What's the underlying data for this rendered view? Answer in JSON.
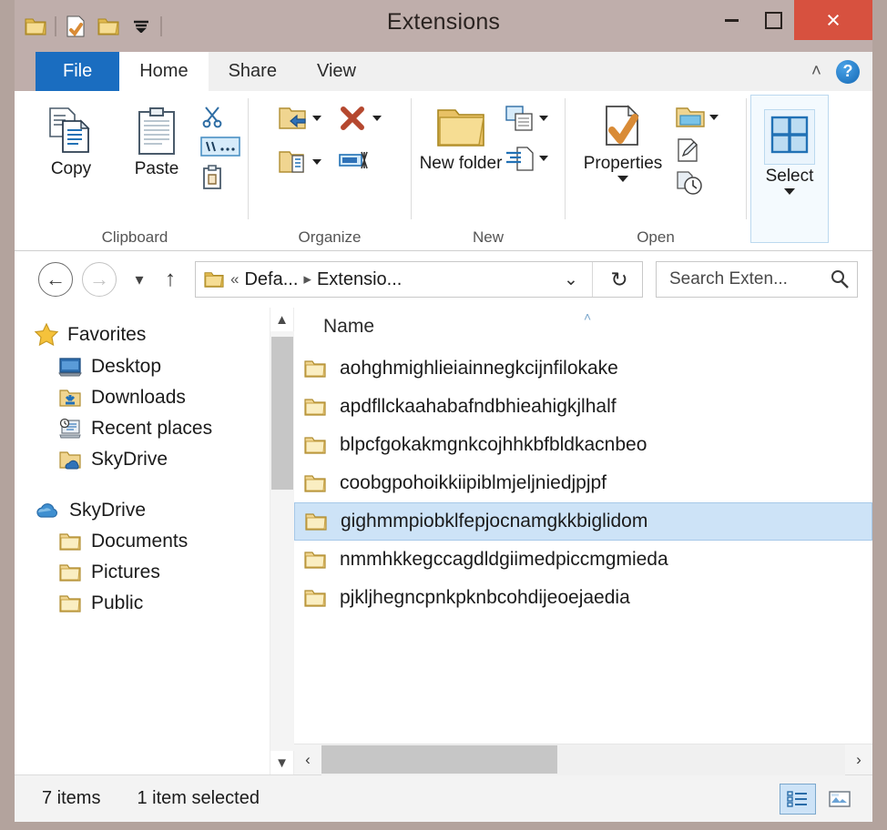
{
  "window": {
    "title": "Extensions",
    "quick_access": [
      "folder-icon",
      "separator",
      "properties-icon",
      "new-folder-icon",
      "dropdown-caret",
      "separator"
    ],
    "controls": {
      "minimize": "minimize-button",
      "maximize": "maximize-button",
      "close": "×"
    }
  },
  "ribbon": {
    "tabs": [
      {
        "label": "File",
        "state": "file"
      },
      {
        "label": "Home",
        "state": "active"
      },
      {
        "label": "Share",
        "state": "normal"
      },
      {
        "label": "View",
        "state": "normal"
      }
    ],
    "collapse_icon": "˄",
    "help_label": "?",
    "groups": [
      {
        "name": "Clipboard",
        "label": "Clipboard",
        "big_buttons": [
          {
            "label": "Copy",
            "icon": "copy-icon"
          },
          {
            "label": "Paste",
            "icon": "paste-icon"
          }
        ],
        "small_buttons": [
          {
            "icon": "cut-icon"
          },
          {
            "icon": "copy-path-icon"
          },
          {
            "icon": "paste-shortcut-icon"
          }
        ]
      },
      {
        "name": "Organize",
        "label": "Organize",
        "small_buttons": [
          {
            "icon": "move-to-icon",
            "caret": true
          },
          {
            "icon": "copy-to-icon",
            "caret": true
          },
          {
            "icon": "delete-icon",
            "caret": true
          },
          {
            "icon": "rename-icon",
            "caret": false
          }
        ]
      },
      {
        "name": "New",
        "label": "New",
        "big_buttons": [
          {
            "label": "New folder",
            "icon": "new-folder-icon"
          }
        ],
        "small_buttons": [
          {
            "icon": "new-item-icon",
            "caret": true
          },
          {
            "icon": "easy-access-icon",
            "caret": true
          }
        ]
      },
      {
        "name": "Open",
        "label": "Open",
        "big_buttons": [
          {
            "label": "Properties",
            "icon": "properties-icon",
            "caret": true
          }
        ],
        "small_buttons": [
          {
            "icon": "open-icon",
            "caret": true
          },
          {
            "icon": "edit-icon",
            "caret": false
          },
          {
            "icon": "history-icon",
            "caret": false
          }
        ]
      },
      {
        "name": "Select",
        "label": "",
        "big_buttons": [
          {
            "label": "Select",
            "icon": "select-grid-icon",
            "caret": true
          }
        ]
      }
    ]
  },
  "addressbar": {
    "back": "←",
    "forward": "→",
    "recent_caret": "▾",
    "up": "↑",
    "breadcrumb": {
      "icon": "folder-icon",
      "overflow": "«",
      "items": [
        "Defa...",
        "Extensio..."
      ],
      "separator": "▸",
      "caret": "⌄"
    },
    "refresh_icon": "↻",
    "search": {
      "placeholder": "Search Exten...",
      "icon": "search-icon"
    }
  },
  "navpane": {
    "sections": [
      {
        "root": {
          "label": "Favorites",
          "icon": "star-icon"
        },
        "items": [
          {
            "label": "Desktop",
            "icon": "desktop-icon"
          },
          {
            "label": "Downloads",
            "icon": "downloads-folder-icon"
          },
          {
            "label": "Recent places",
            "icon": "recent-places-icon"
          },
          {
            "label": "SkyDrive",
            "icon": "skydrive-folder-icon"
          }
        ]
      },
      {
        "root": {
          "label": "SkyDrive",
          "icon": "cloud-icon"
        },
        "items": [
          {
            "label": "Documents",
            "icon": "folder-icon"
          },
          {
            "label": "Pictures",
            "icon": "folder-icon"
          },
          {
            "label": "Public",
            "icon": "folder-icon"
          }
        ]
      }
    ]
  },
  "filelist": {
    "column_header": "Name",
    "sort_marker": "˄",
    "rows": [
      {
        "name": "aohghmighlieiainnegkcijnfilokake",
        "selected": false
      },
      {
        "name": "apdfllckaahabafndbhieahigkjlhalf",
        "selected": false
      },
      {
        "name": "blpcfgokakmgnkcojhhkbfbldkacnbeo",
        "selected": false
      },
      {
        "name": "coobgpohoikkiipiblmjeljniedjpjpf",
        "selected": false
      },
      {
        "name": "gighmmpiobklfepjocnamgkkbiglidom",
        "selected": true
      },
      {
        "name": "nmmhkkegccagdldgiimedpiccmgmieda",
        "selected": false
      },
      {
        "name": "pjkljhegncpnkpknbcohdijeoejaedia",
        "selected": false
      }
    ],
    "hscroll": {
      "left": "‹",
      "right": "›"
    }
  },
  "statusbar": {
    "item_count": "7 items",
    "selection": "1 item selected",
    "views": [
      {
        "name": "details-view",
        "active": true
      },
      {
        "name": "large-icons-view",
        "active": false
      }
    ]
  },
  "colors": {
    "title_bar": "#bfaeab",
    "close_button": "#d7513f",
    "file_tab": "#1a6dc0",
    "selection": "#cde3f7",
    "folder_yellow": "#f0cf7a"
  }
}
